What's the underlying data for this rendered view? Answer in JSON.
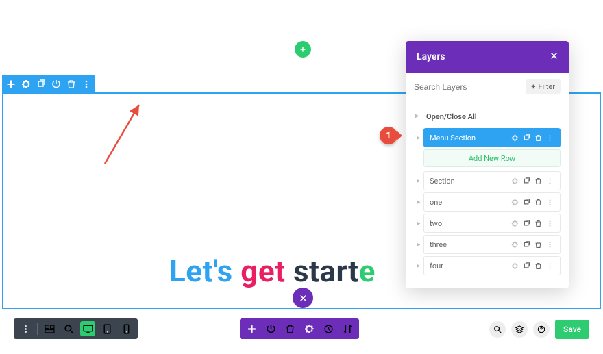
{
  "add_section_icon": "plus-icon",
  "section_toolbar_icons": [
    "move-icon",
    "gear-icon",
    "duplicate-icon",
    "power-icon",
    "trash-icon",
    "more-icon"
  ],
  "hero_text": {
    "w1": "Let's ",
    "w2": "get ",
    "w3_a": "start",
    "w3_b": "e"
  },
  "layers_panel": {
    "title": "Layers",
    "search_placeholder": "Search Layers",
    "filter_label": "Filter",
    "open_close_label": "Open/Close All",
    "active_item": {
      "label": "Menu Section"
    },
    "add_new_row_label": "Add New Row",
    "items": [
      {
        "label": "Section"
      },
      {
        "label": "one"
      },
      {
        "label": "two"
      },
      {
        "label": "three"
      },
      {
        "label": "four"
      }
    ],
    "row_action_icons": [
      "gear-icon",
      "duplicate-icon",
      "trash-icon",
      "more-icon"
    ]
  },
  "callout_number": "1",
  "bottom_left_icons": [
    "more-icon",
    "wireframe-icon",
    "zoom-icon",
    "desktop-icon",
    "tablet-icon",
    "phone-icon"
  ],
  "bottom_center_icons": [
    "plus-icon",
    "power-icon",
    "trash-icon",
    "gear-icon",
    "history-icon",
    "sort-icon"
  ],
  "bottom_right": {
    "circles": [
      "search-icon",
      "layers-icon",
      "help-icon"
    ],
    "save_label": "Save"
  }
}
